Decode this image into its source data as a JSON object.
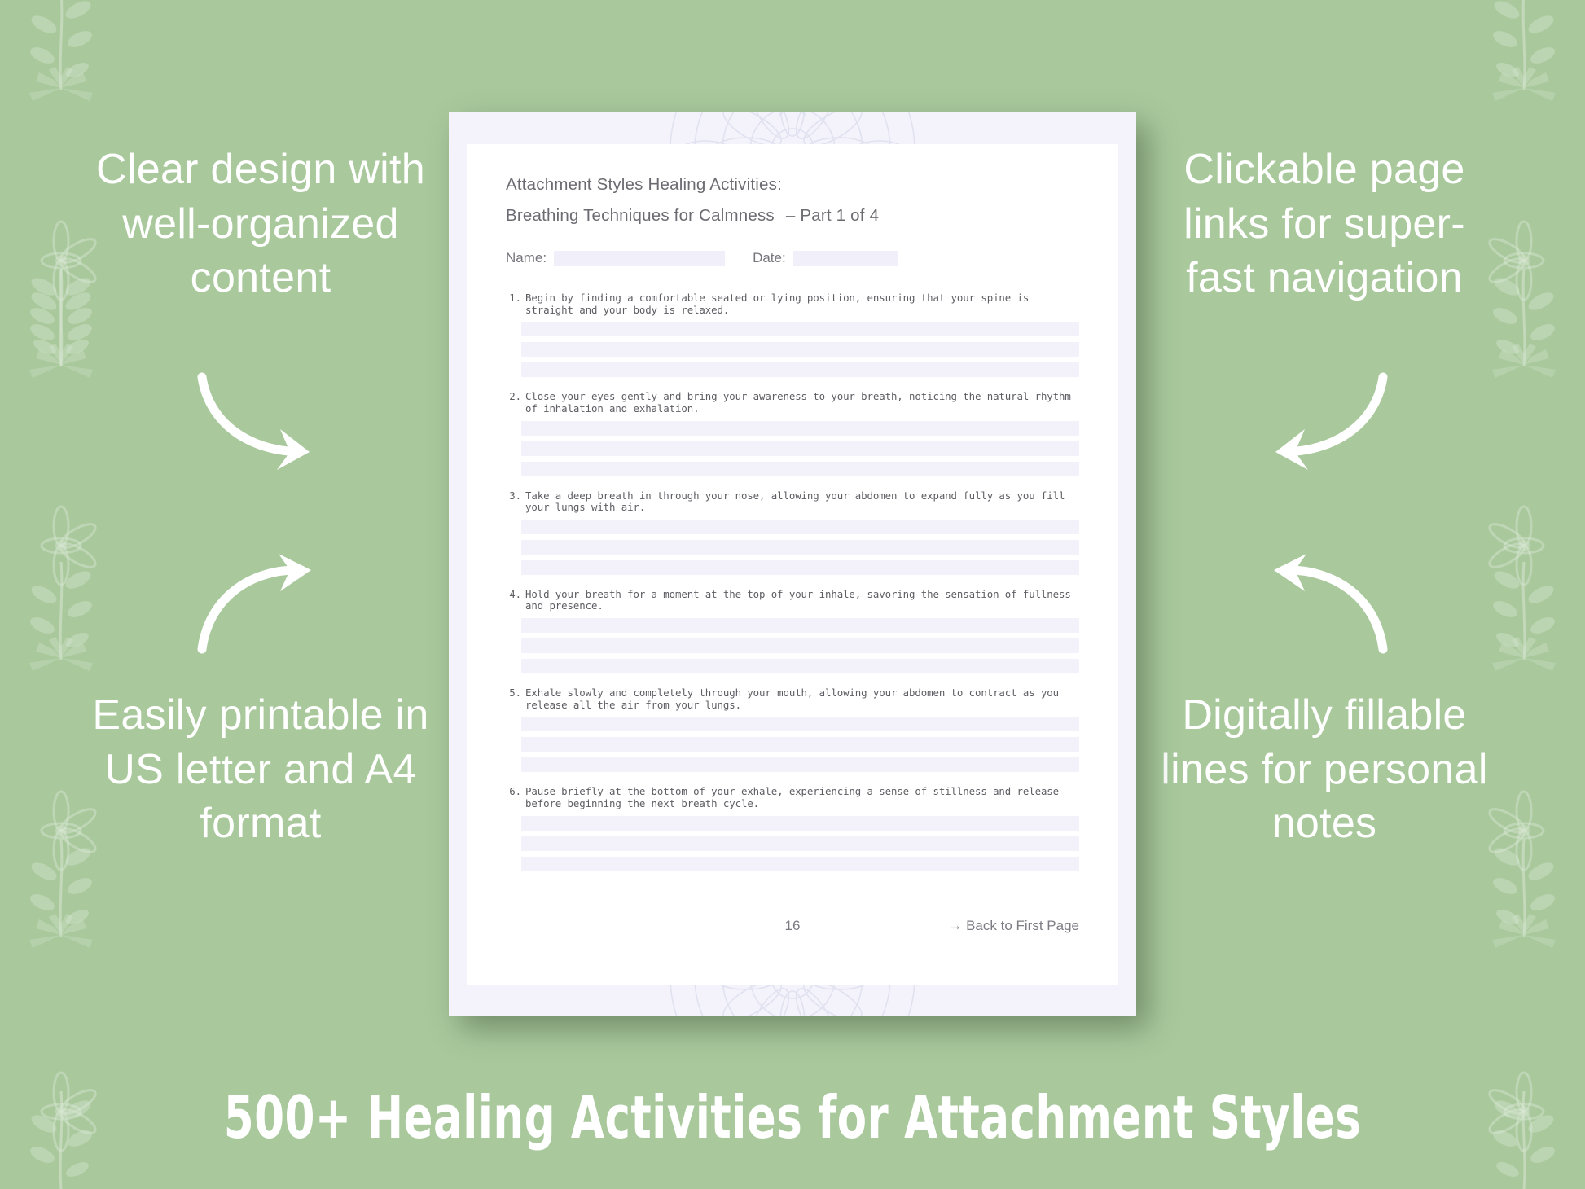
{
  "theme": {
    "background_green": "#a9c99d",
    "page_border_lavender": "#f4f2fb",
    "fill_line_lavender": "#f3f1fa",
    "text_gray": "#6b6b72",
    "white": "#ffffff"
  },
  "promos": {
    "top_left": "Clear design with well-organized content",
    "bottom_left": "Easily printable in US letter and A4 format",
    "top_right": "Clickable page links for super-fast navigation",
    "bottom_right": "Digitally fillable lines for personal notes"
  },
  "document": {
    "title": "Attachment Styles Healing Activities:",
    "subtitle": "Breathing Techniques for Calmness",
    "part_label": "– Part 1 of 4",
    "name_label": "Name:",
    "date_label": "Date:",
    "items": [
      {
        "num": "1.",
        "text": "Begin by finding a comfortable seated or lying position, ensuring that your spine is straight and your body is relaxed."
      },
      {
        "num": "2.",
        "text": "Close your eyes gently and bring your awareness to your breath, noticing the natural rhythm of inhalation and exhalation."
      },
      {
        "num": "3.",
        "text": "Take a deep breath in through your nose, allowing your abdomen to expand fully as you fill your lungs with air."
      },
      {
        "num": "4.",
        "text": "Hold your breath for a moment at the top of your inhale, savoring the sensation of fullness and presence."
      },
      {
        "num": "5.",
        "text": "Exhale slowly and completely through your mouth, allowing your abdomen to contract as you release all the air from your lungs."
      },
      {
        "num": "6.",
        "text": "Pause briefly at the bottom of your exhale, experiencing a sense of stillness and release before beginning the next breath cycle."
      }
    ],
    "page_number": "16",
    "back_link": "→ Back to First Page"
  },
  "banner": {
    "headline": "500+ Healing Activities for Attachment Styles"
  },
  "icons": {
    "arrow_top_left": "curved-arrow-down-right-icon",
    "arrow_bottom_left": "curved-arrow-up-right-icon",
    "arrow_top_right": "curved-arrow-down-left-icon",
    "arrow_bottom_right": "curved-arrow-up-left-icon",
    "floral_border": "floral-vine-icon",
    "mandala": "mandala-watermark-icon"
  }
}
